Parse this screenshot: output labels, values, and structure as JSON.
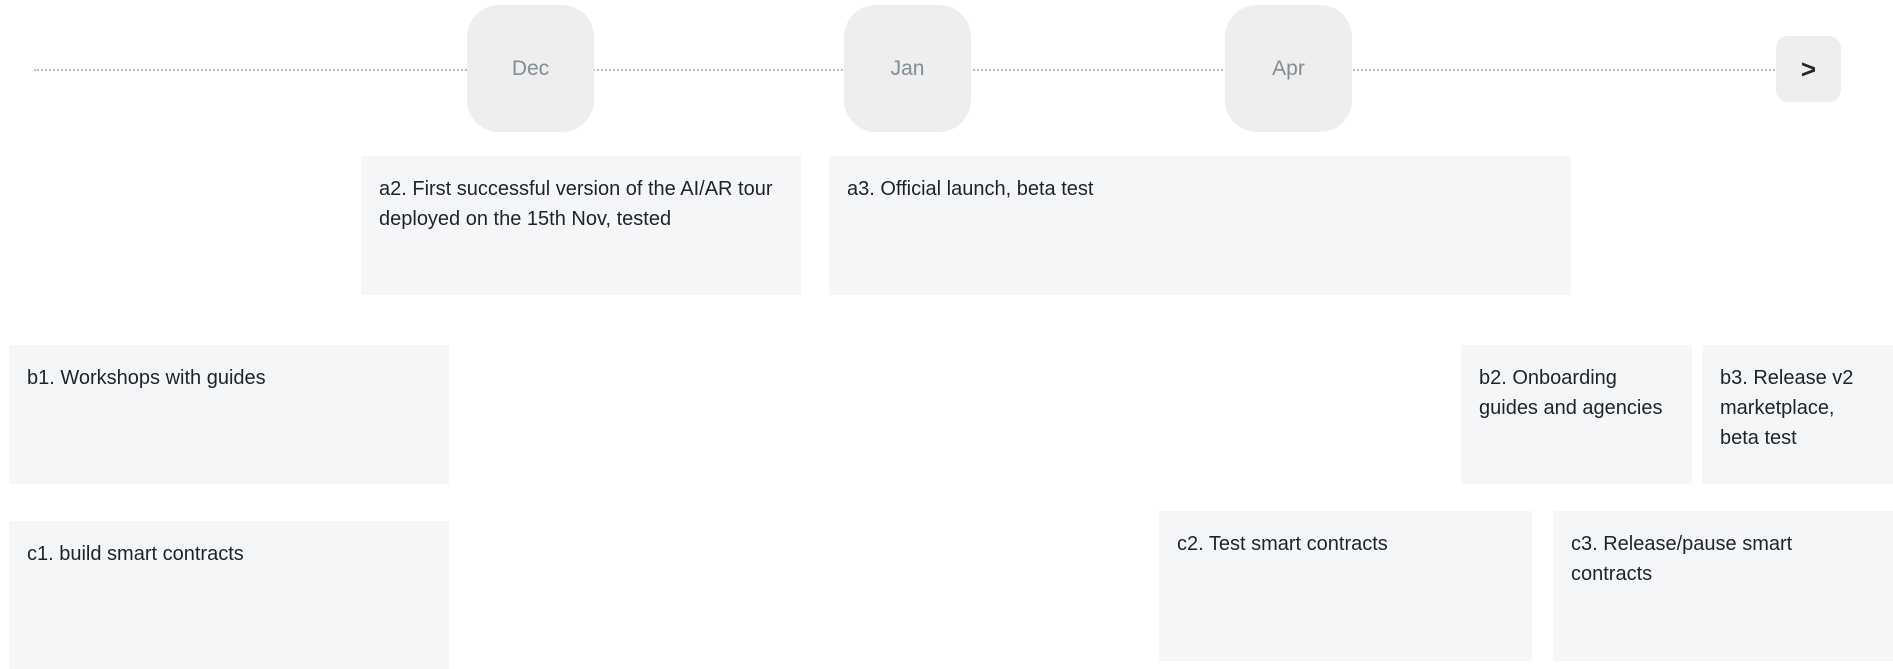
{
  "timeline": {
    "months": [
      "Dec",
      "Jan",
      "Apr"
    ],
    "next_label": ">"
  },
  "cards": {
    "a2": "a2. First successful version of the AI/AR tour deployed on the 15th Nov, tested",
    "a3": "a3. Official launch, beta test",
    "b1": "b1. Workshops with guides",
    "b2": "b2. Onboarding guides and agencies",
    "b3": "b3. Release v2 marketplace, beta test",
    "c1": "c1. build smart contracts",
    "c2": "c2. Test smart contracts",
    "c3": "c3. Release/pause smart contracts"
  },
  "colors": {
    "pill_bg": "#eeeeee",
    "month_text": "#7f8d95",
    "card_bg": "#f5f6f7"
  }
}
